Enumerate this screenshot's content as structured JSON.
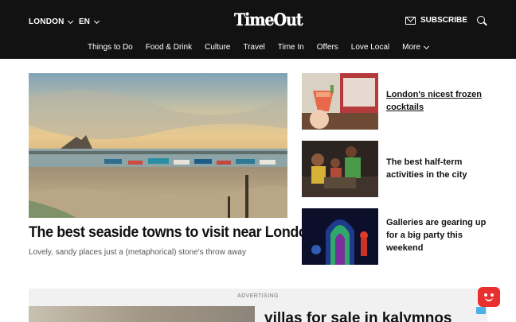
{
  "header": {
    "city": "LONDON",
    "language": "EN",
    "logo": "TimeOut",
    "subscribe": "SUBSCRIBE",
    "nav": [
      {
        "label": "Things to Do"
      },
      {
        "label": "Food & Drink"
      },
      {
        "label": "Culture"
      },
      {
        "label": "Travel"
      },
      {
        "label": "Time In"
      },
      {
        "label": "Offers"
      },
      {
        "label": "Love Local"
      },
      {
        "label": "More"
      }
    ]
  },
  "hero": {
    "title": "The best seaside towns to visit near London",
    "subtitle": "Lovely, sandy places just a (metaphorical) stone's throw away"
  },
  "cards": [
    {
      "title": "London's nicest frozen cocktails"
    },
    {
      "title": "The best half-term activities in the city"
    },
    {
      "title": "Galleries are gearing up for a big party this weekend"
    }
  ],
  "ad": {
    "label": "ADVERTISING",
    "text": "villas for sale in kalymnos"
  },
  "colors": {
    "header_bg": "#121212",
    "accent_red": "#e8312f"
  }
}
